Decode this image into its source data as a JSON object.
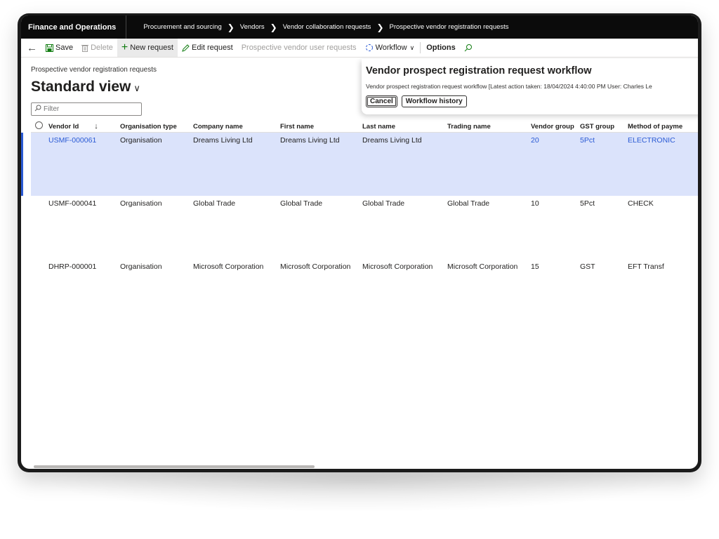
{
  "app": {
    "title": "Finance and Operations"
  },
  "breadcrumb": [
    "Procurement and sourcing",
    "Vendors",
    "Vendor collaboration requests",
    "Prospective vendor registration requests"
  ],
  "actions": {
    "save": "Save",
    "delete": "Delete",
    "new_request": "New request",
    "edit_request": "Edit request",
    "prospective_users": "Prospective vendor user requests",
    "workflow": "Workflow",
    "options": "Options"
  },
  "page": {
    "caption": "Prospective vendor registration requests",
    "view_name": "Standard view",
    "filter_placeholder": "Filter"
  },
  "workflow_panel": {
    "title": "Vendor prospect registration request workflow",
    "description": "Vendor prospect registration request workflow [Latest action taken: 18/04/2024 4:40:00 PM User: Charles Le",
    "cancel": "Cancel",
    "history": "Workflow history"
  },
  "grid": {
    "columns": [
      "Vendor Id",
      "Organisation type",
      "Company name",
      "First name",
      "Last name",
      "Trading name",
      "Vendor group",
      "GST group",
      "Method of payme"
    ],
    "rows": [
      [
        "USMF-000061",
        "Organisation",
        "Dreams Living Ltd",
        "Dreams Living Ltd",
        "Dreams Living Ltd",
        "",
        "20",
        "5Pct",
        "ELECTRONIC"
      ],
      [
        "USMF-000041",
        "Organisation",
        "Global Trade",
        "Global Trade",
        "Global Trade",
        "Global Trade",
        "10",
        "5Pct",
        "CHECK"
      ],
      [
        "DHRP-000001",
        "Organisation",
        "Microsoft Corporation",
        "Microsoft Corporation",
        "Microsoft Corporation",
        "Microsoft Corporation",
        "15",
        "GST",
        "EFT Transf"
      ]
    ]
  },
  "colors": {
    "accent": "#2a5ad4",
    "selected_row": "#dbe3fb",
    "navbar": "#0b0b0b",
    "new_icon": "#107c10"
  }
}
